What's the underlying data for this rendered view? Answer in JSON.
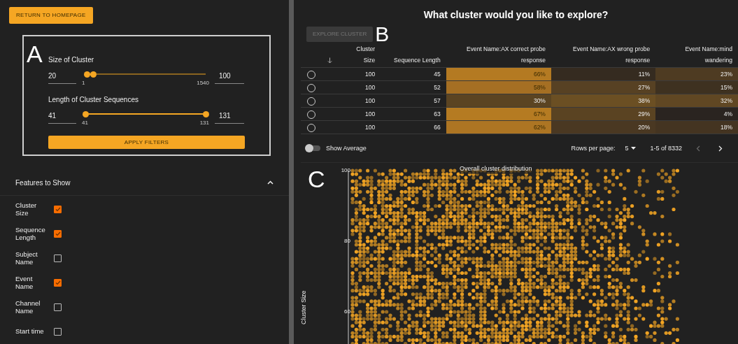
{
  "return_button": "RETURN TO HOMEPAGE",
  "annotations": [
    "A",
    "B",
    "C"
  ],
  "filters": {
    "sliders": [
      {
        "label": "Size of Cluster",
        "min_value": "20",
        "max_value": "100",
        "range_min": "1",
        "range_max": "1540",
        "low": {
          "level": 0.012
        },
        "high": {
          "level": 0.065
        }
      },
      {
        "label": "Length of Cluster Sequences",
        "min_value": "41",
        "max_value": "131",
        "range_min": "41",
        "range_max": "131",
        "low": {
          "level": 0
        },
        "high": {
          "level": 1
        }
      }
    ],
    "apply_button": "APPLY FILTERS"
  },
  "features": {
    "title": "Features to Show",
    "expanded": true,
    "items": [
      {
        "label": "Cluster Size",
        "checked": true
      },
      {
        "label": "Sequence Length",
        "checked": true
      },
      {
        "label": "Subject Name",
        "checked": false
      },
      {
        "label": "Event Name",
        "checked": true
      },
      {
        "label": "Channel Name",
        "checked": false
      },
      {
        "label": "Start time",
        "checked": false
      }
    ]
  },
  "title": "What cluster would you like to explore?",
  "explore_button": {
    "label": "EXPLORE CLUSTER",
    "disabled": true
  },
  "table": {
    "columns": [
      "Cluster Size",
      "Sequence Length",
      "Event Name:AX correct probe response",
      "Event Name:AX wrong probe response",
      "Event Name:mind wandering"
    ],
    "rows": [
      {
        "selected": false,
        "cells": [
          "100",
          "45"
        ],
        "heat": [
          {
            "text": "66%",
            "color": "#b47a22"
          },
          {
            "text": "11%",
            "color": "#352b20"
          },
          {
            "text": "23%",
            "color": "#4e3b22"
          }
        ]
      },
      {
        "selected": false,
        "cells": [
          "100",
          "52"
        ],
        "heat": [
          {
            "text": "58%",
            "color": "#a56f23"
          },
          {
            "text": "27%",
            "color": "#574123"
          },
          {
            "text": "15%",
            "color": "#3e3120"
          }
        ]
      },
      {
        "selected": false,
        "cells": [
          "100",
          "57"
        ],
        "heat": [
          {
            "text": "30%",
            "color": "#5b4422"
          },
          {
            "text": "38%",
            "color": "#6b4f23"
          },
          {
            "text": "32%",
            "color": "#604723"
          }
        ]
      },
      {
        "selected": false,
        "cells": [
          "100",
          "63"
        ],
        "heat": [
          {
            "text": "67%",
            "color": "#b57b22"
          },
          {
            "text": "29%",
            "color": "#5a4322"
          },
          {
            "text": "4%",
            "color": "#2a2420"
          }
        ]
      },
      {
        "selected": false,
        "cells": [
          "100",
          "66"
        ],
        "heat": [
          {
            "text": "62%",
            "color": "#ad7523"
          },
          {
            "text": "20%",
            "color": "#4a3822"
          },
          {
            "text": "18%",
            "color": "#443421"
          }
        ]
      }
    ]
  },
  "show_average": {
    "label": "Show Average",
    "on": false
  },
  "pagination": {
    "rows_label": "Rows per page:",
    "rows_value": "5",
    "range": "1-5 of 8332",
    "prev_disabled": true,
    "next_disabled": false
  },
  "chart": {
    "title": "Overall cluster distribution",
    "ylabel": "Cluster Size",
    "yticks": [
      "100",
      "80",
      "60"
    ]
  }
}
